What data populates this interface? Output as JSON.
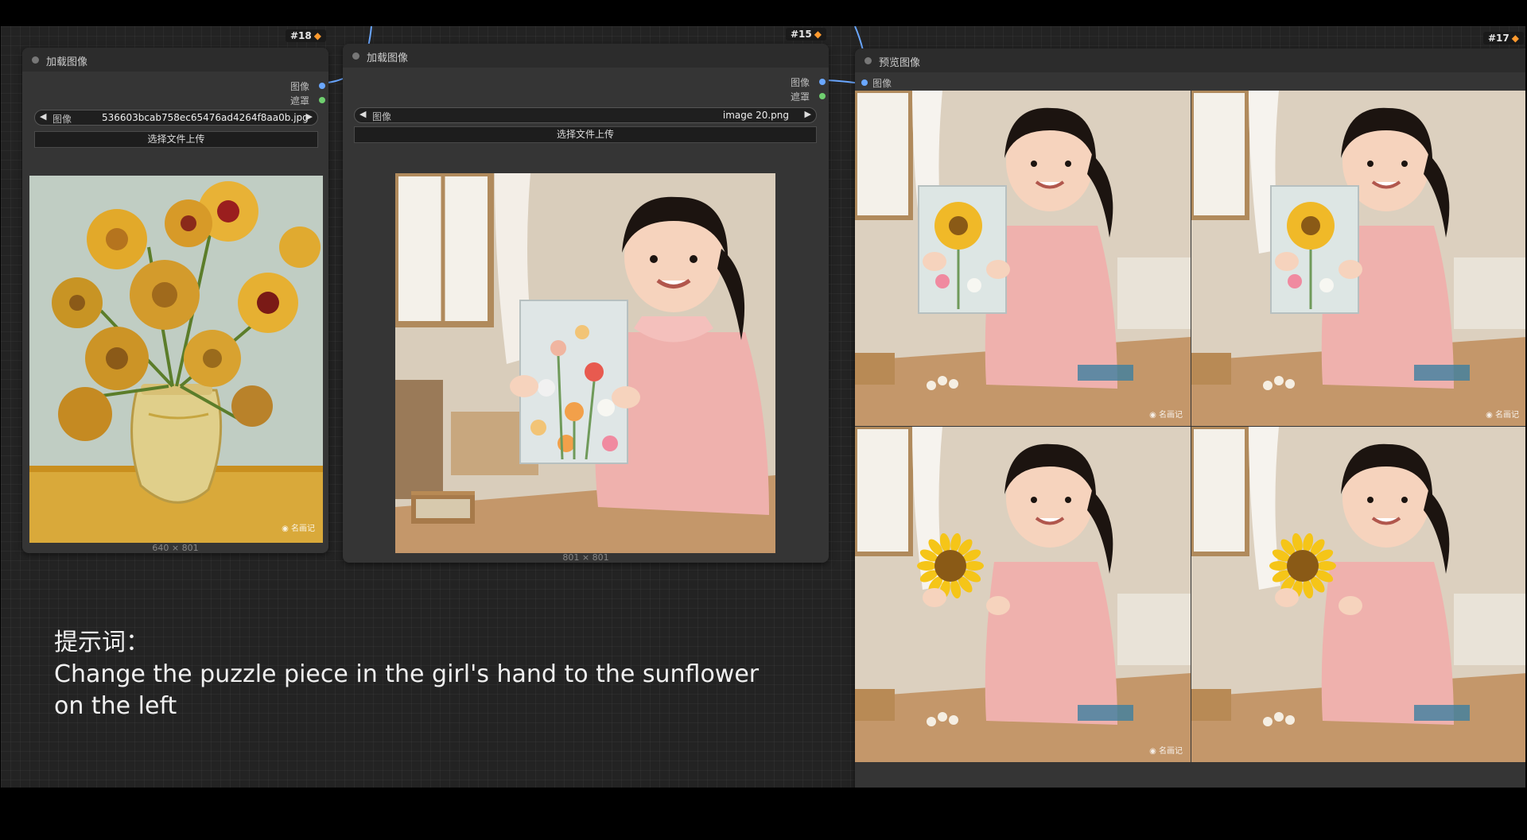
{
  "nodes": {
    "load1": {
      "id": "#18",
      "title": "加载图像",
      "out_image": "图像",
      "out_mask": "遮罩",
      "widget_label": "图像",
      "widget_value": "536603bcab758ec65476ad4264f8aa0b.jpg",
      "upload": "选择文件上传",
      "dims": "640 × 801",
      "watermark": "名画记"
    },
    "load2": {
      "id": "#15",
      "title": "加载图像",
      "out_image": "图像",
      "out_mask": "遮罩",
      "widget_label": "图像",
      "widget_value": "image 20.png",
      "upload": "选择文件上传",
      "dims": "801 × 801"
    },
    "preview": {
      "id": "#17",
      "title": "预览图像",
      "in_image": "图像",
      "watermark": "名画记"
    }
  },
  "prompt": {
    "label": "提示词：",
    "line1": "Change the puzzle piece in the girl's hand to the sunflower",
    "line2": "on the left"
  },
  "colors": {
    "canvas": "#232323",
    "node": "#353535",
    "link": "#6aa7ff",
    "mask_socket": "#6fcf6f",
    "badge_icon": "#ff9a2e"
  },
  "icons": {
    "badge": "fox-icon",
    "prev": "triangle-left-icon",
    "next": "triangle-right-icon",
    "watermark": "wechat-icon"
  }
}
